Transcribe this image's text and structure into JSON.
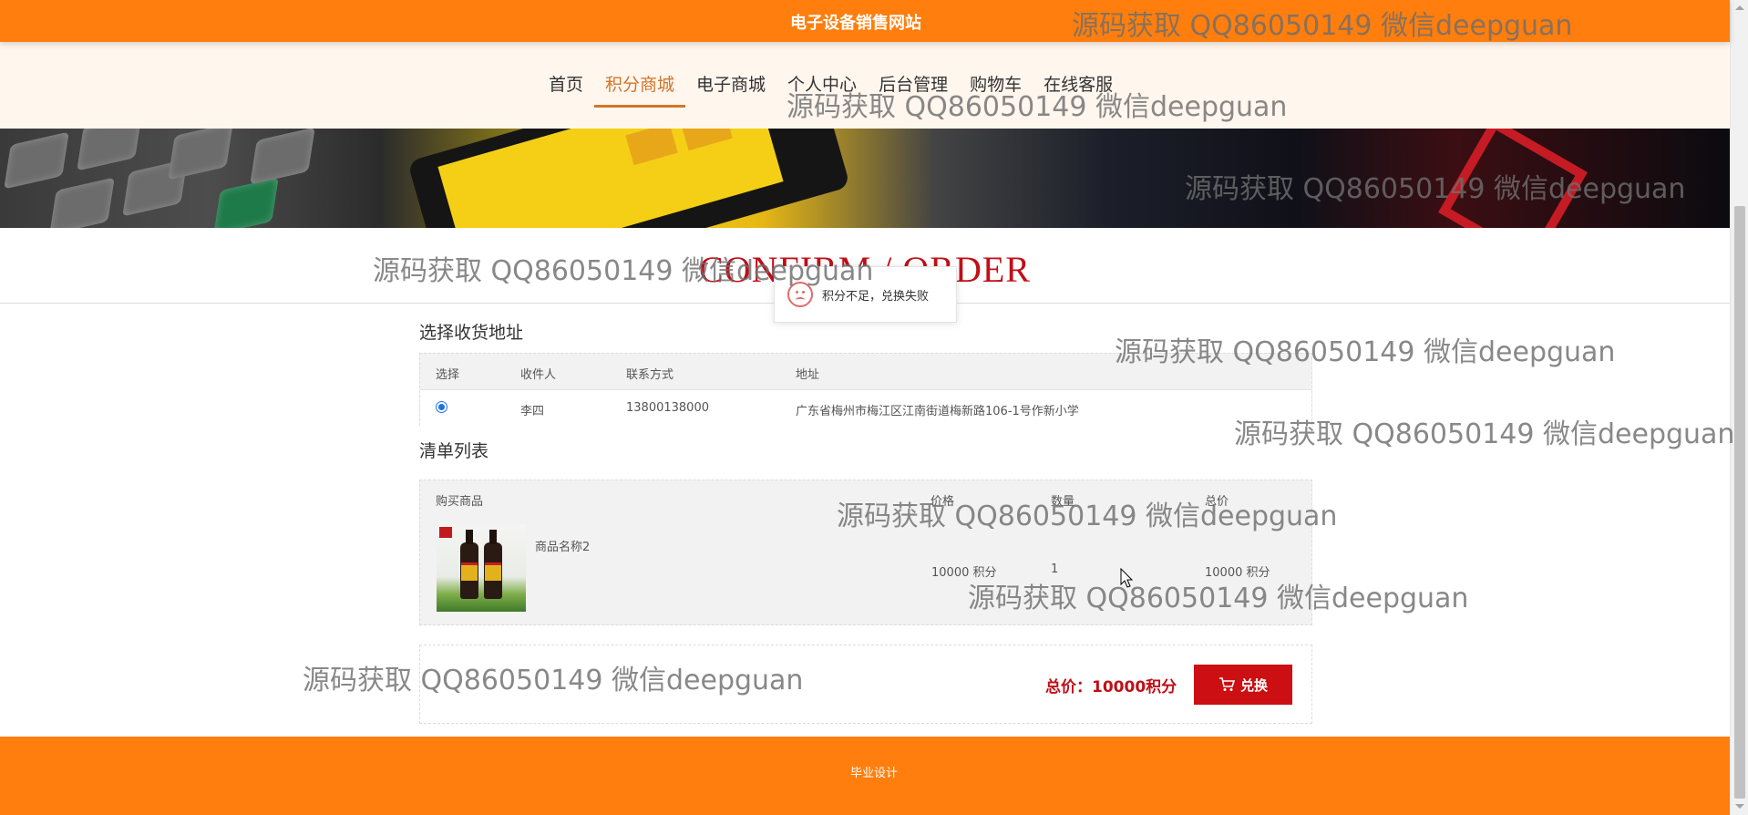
{
  "header": {
    "site_title": "电子设备销售网站"
  },
  "nav": {
    "items": [
      {
        "label": "首页"
      },
      {
        "label": "积分商城"
      },
      {
        "label": "电子商城"
      },
      {
        "label": "个人中心"
      },
      {
        "label": "后台管理"
      },
      {
        "label": "购物车"
      },
      {
        "label": "在线客服"
      }
    ],
    "active": "积分商城"
  },
  "page": {
    "heading": "CONFIRM / ORDER"
  },
  "toast": {
    "message": "积分不足，兑换失败"
  },
  "address_section": {
    "title": "选择收货地址",
    "columns": [
      "选择",
      "收件人",
      "联系方式",
      "地址"
    ],
    "rows": [
      {
        "recipient": "李四",
        "phone": "13800138000",
        "address": "广东省梅州市梅江区江南街道梅新路106-1号作新小学",
        "selected": true
      }
    ]
  },
  "list_section": {
    "title": "清单列表",
    "columns": [
      "购买商品",
      "价格",
      "数量",
      "总价"
    ],
    "items": [
      {
        "name": "商品名称2",
        "price": "10000 积分",
        "quantity": "1",
        "total": "10000 积分"
      }
    ]
  },
  "summary": {
    "total_text": "总价：10000积分",
    "exchange_label": "兑换"
  },
  "footer": {
    "text": "毕业设计"
  },
  "watermark_text": "源码获取 QQ86050149 微信deepguan",
  "colors": {
    "brand_orange": "#ff7e0d",
    "accent_red": "#c10f17",
    "nav_active": "#d3752a"
  }
}
